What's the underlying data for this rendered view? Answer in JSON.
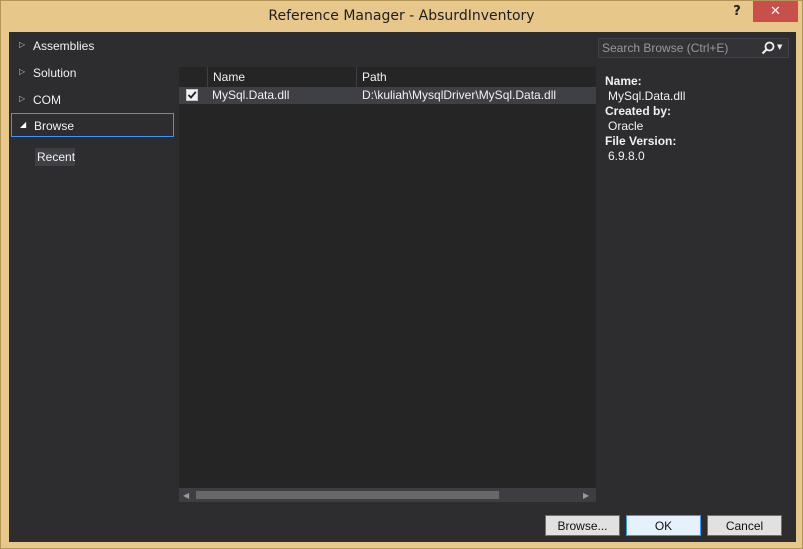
{
  "window": {
    "title": "Reference Manager - AbsurdInventory",
    "help": "?",
    "close": "✕"
  },
  "nav": {
    "items": [
      {
        "label": "Assemblies",
        "expanded": false
      },
      {
        "label": "Solution",
        "expanded": false
      },
      {
        "label": "COM",
        "expanded": false
      },
      {
        "label": "Browse",
        "expanded": true
      }
    ],
    "sub_item": "Recent"
  },
  "search": {
    "placeholder": "Search Browse (Ctrl+E)"
  },
  "list": {
    "columns": [
      "Name",
      "Path"
    ],
    "rows": [
      {
        "checked": true,
        "name": "MySql.Data.dll",
        "path": "D:\\kuliah\\MysqlDriver\\MySql.Data.dll"
      }
    ]
  },
  "details": {
    "name_label": "Name:",
    "name_value": "MySql.Data.dll",
    "created_label": "Created by:",
    "created_value": "Oracle",
    "version_label": "File Version:",
    "version_value": "6.9.8.0"
  },
  "buttons": {
    "browse": "Browse...",
    "ok": "OK",
    "cancel": "Cancel"
  },
  "colors": {
    "accent": "#3399ff",
    "close": "#c7504a",
    "frame": "#e8c88a",
    "panel": "#2d2d30"
  }
}
